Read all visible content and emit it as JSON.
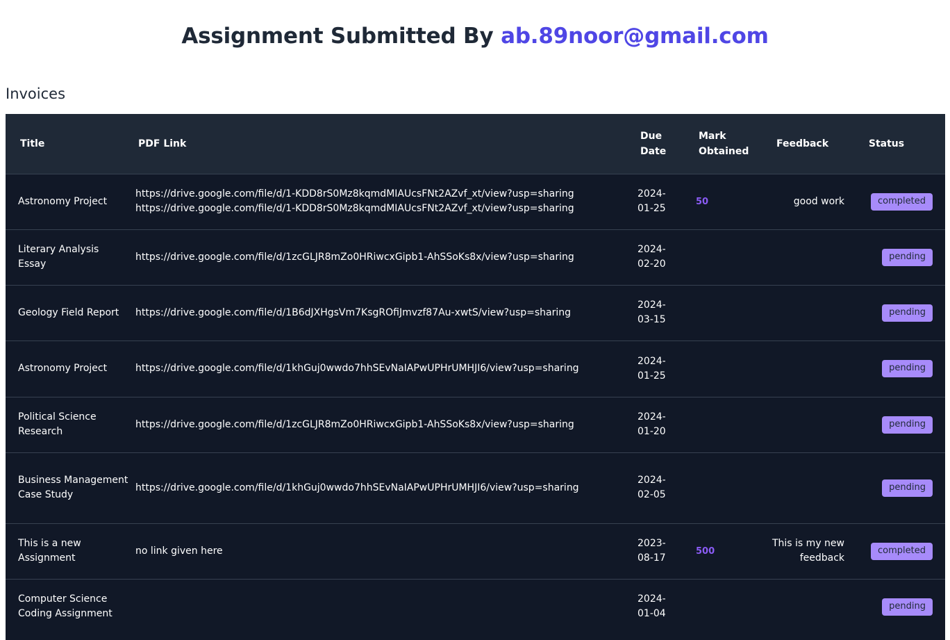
{
  "header": {
    "prefix": "Assignment Submitted By ",
    "email": "ab.89noor@gmail.com"
  },
  "section_title": "Invoices",
  "table": {
    "columns": {
      "title": "Title",
      "pdf": "PDF Link",
      "due_l1": "Due",
      "due_l2": "Date",
      "mark_l1": "Mark",
      "mark_l2": "Obtained",
      "feedback": "Feedback",
      "status": "Status"
    },
    "rows": [
      {
        "title": "Astronomy Project",
        "pdf1": "https://drive.google.com/file/d/1-KDD8rS0Mz8kqmdMIAUcsFNt2AZvf_xt/view?usp=sharing",
        "pdf2": "https://drive.google.com/file/d/1-KDD8rS0Mz8kqmdMIAUcsFNt2AZvf_xt/view?usp=sharing",
        "due1": "2024-",
        "due2": "01-25",
        "mark": "50",
        "feedback1": "good work",
        "feedback2": "",
        "status": "completed"
      },
      {
        "title": "Literary Analysis Essay",
        "pdf1": "https://drive.google.com/file/d/1zcGLJR8mZo0HRiwcxGipb1-AhSSoKs8x/view?usp=sharing",
        "pdf2": "",
        "due1": "2024-",
        "due2": "02-20",
        "mark": "",
        "feedback1": "",
        "feedback2": "",
        "status": "pending"
      },
      {
        "title": "Geology Field Report",
        "pdf1": "https://drive.google.com/file/d/1B6dJXHgsVm7KsgROfiJmvzf87Au-xwtS/view?usp=sharing",
        "pdf2": "",
        "due1": "2024-",
        "due2": "03-15",
        "mark": "",
        "feedback1": "",
        "feedback2": "",
        "status": "pending"
      },
      {
        "title": "Astronomy Project",
        "pdf1": "https://drive.google.com/file/d/1khGuj0wwdo7hhSEvNaIAPwUPHrUMHJI6/view?usp=sharing",
        "pdf2": "",
        "due1": "2024-",
        "due2": "01-25",
        "mark": "",
        "feedback1": "",
        "feedback2": "",
        "status": "pending"
      },
      {
        "title": "Political Science Research",
        "pdf1": "https://drive.google.com/file/d/1zcGLJR8mZo0HRiwcxGipb1-AhSSoKs8x/view?usp=sharing",
        "pdf2": "",
        "due1": "2024-",
        "due2": "01-20",
        "mark": "",
        "feedback1": "",
        "feedback2": "",
        "status": "pending"
      },
      {
        "title": "Business Management Case Study",
        "pdf1": "https://drive.google.com/file/d/1khGuj0wwdo7hhSEvNaIAPwUPHrUMHJI6/view?usp=sharing",
        "pdf2": "",
        "due1": "2024-",
        "due2": "02-05",
        "mark": "",
        "feedback1": "",
        "feedback2": "",
        "status": "pending"
      },
      {
        "title": "This is a new Assignment",
        "pdf1": "no link given here",
        "pdf2": "",
        "due1": "2023-",
        "due2": "08-17",
        "mark": "500",
        "feedback1": "This is my new",
        "feedback2": "feedback",
        "status": "completed"
      },
      {
        "title": "Computer Science Coding Assignment",
        "pdf1": "",
        "pdf2": "",
        "due1": "2024-",
        "due2": "01-04",
        "mark": "",
        "feedback1": "",
        "feedback2": "",
        "status": "pending"
      }
    ]
  },
  "colors": {
    "heading_text": "#1f2937",
    "email_accent": "#4f46e5",
    "table_header_bg": "#1f2937",
    "table_body_bg": "#111827",
    "mark_text": "#8b5cf6",
    "badge_bg": "#a78bfa"
  }
}
